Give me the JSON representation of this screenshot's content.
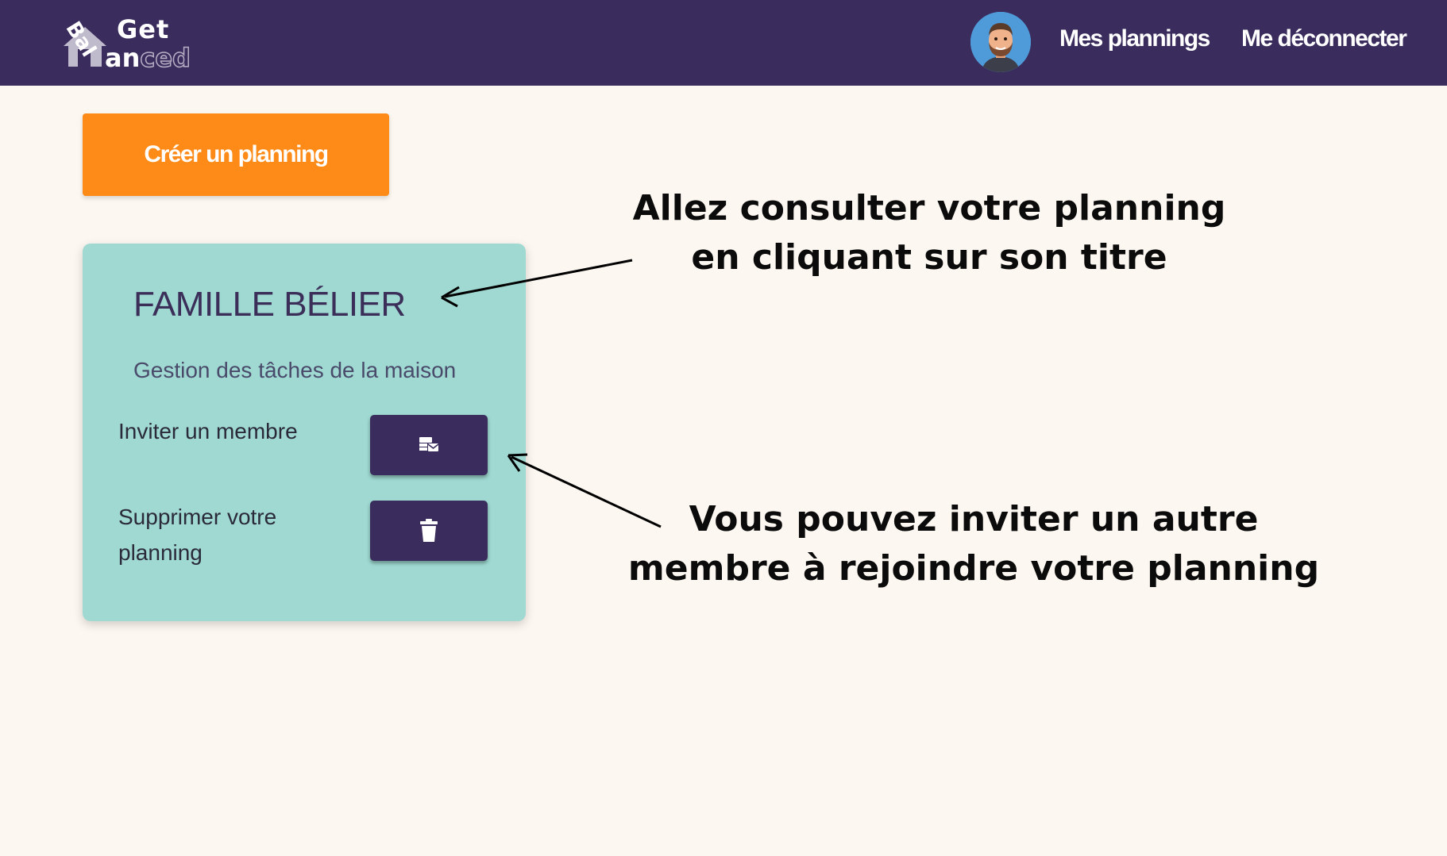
{
  "navbar": {
    "logo": {
      "word_top": "Get",
      "word_rotated": "Bal",
      "word_bottom_a": "an",
      "word_bottom_b": "ced"
    },
    "links": {
      "plannings": "Mes plannings",
      "logout": "Me déconnecter"
    },
    "avatar_icon": "user-avatar",
    "colors": {
      "background": "#3a2c5c",
      "text": "#ffffff"
    }
  },
  "main": {
    "create_button": {
      "label": "Créer un planning",
      "color": "#fe8a17"
    },
    "planning_card": {
      "title": "FAMILLE BÉLIER",
      "description": "Gestion des tâches de la maison",
      "invite": {
        "label": "Inviter un membre",
        "icon": "invite-envelope-icon"
      },
      "delete": {
        "label": "Supprimer votre planning",
        "icon": "trash-icon"
      },
      "colors": {
        "background": "#9fd9d2",
        "button": "#3a2c5c"
      }
    }
  },
  "annotations": {
    "title_hint": {
      "line1": "Allez consulter votre planning",
      "line2": "en cliquant sur son titre"
    },
    "invite_hint": {
      "line1": "Vous pouvez inviter un autre",
      "line2": "membre à rejoindre votre planning"
    }
  }
}
